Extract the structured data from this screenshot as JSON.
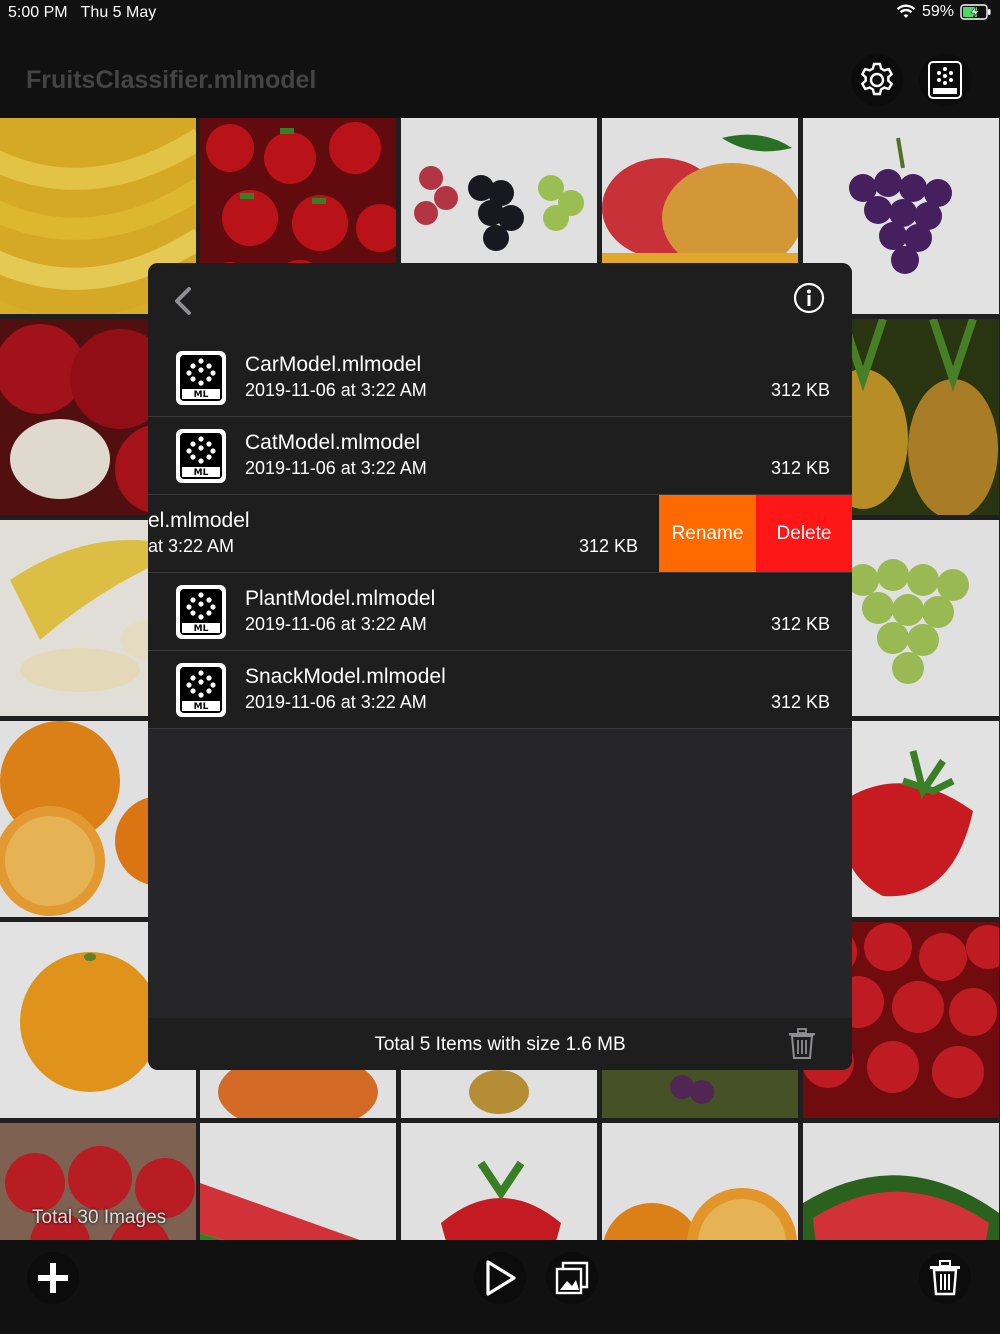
{
  "status_bar": {
    "time": "5:00 PM",
    "date": "Thu 5 May",
    "battery": "59%"
  },
  "nav": {
    "title": "FruitsClassifier.mlmodel",
    "settings_icon": "gear-icon",
    "model_icon": "ml-model-icon"
  },
  "gallery": {
    "total_label": "Total 30 Images"
  },
  "panel": {
    "back_icon": "chevron-left-icon",
    "info_icon": "info-icon",
    "items": [
      {
        "name": "CarModel.mlmodel",
        "date": "2019-11-06 at 3:22 AM",
        "size": "312 KB"
      },
      {
        "name": "CatModel.mlmodel",
        "date": "2019-11-06 at 3:22 AM",
        "size": "312 KB"
      },
      {
        "name": "el.mlmodel",
        "date": " at 3:22 AM",
        "size": "312 KB",
        "swiped": true
      },
      {
        "name": "PlantModel.mlmodel",
        "date": "2019-11-06 at 3:22 AM",
        "size": "312 KB"
      },
      {
        "name": "SnackModel.mlmodel",
        "date": "2019-11-06 at 3:22 AM",
        "size": "312 KB"
      }
    ],
    "swipe_actions": {
      "rename": "Rename",
      "delete": "Delete"
    },
    "footer": {
      "summary": "Total 5 Items with size 1.6 MB"
    }
  },
  "colors": {
    "rename": "#ff6a00",
    "delete": "#ff1616",
    "panel_bg": "#262628",
    "row_bg": "#1e1e1f"
  }
}
